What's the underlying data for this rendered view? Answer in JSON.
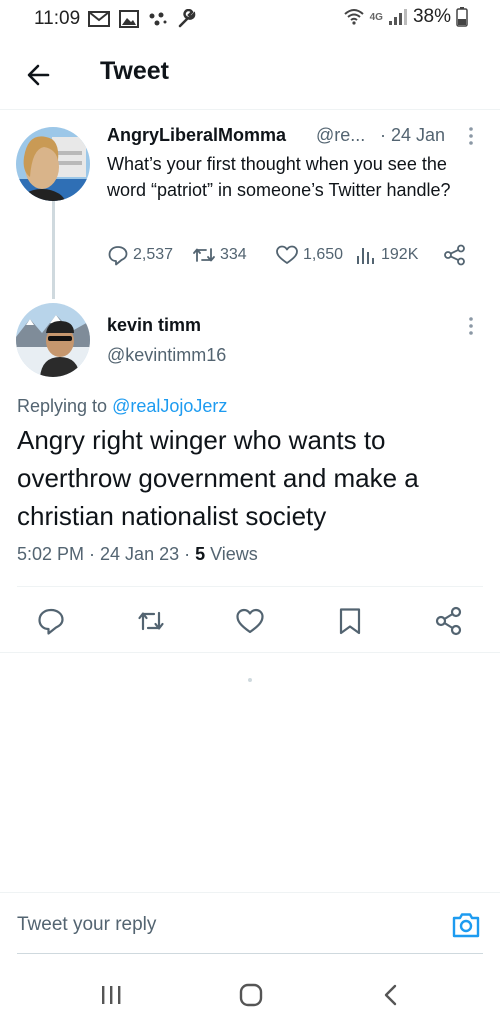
{
  "status_bar": {
    "time": "11:09",
    "left_icons": [
      "gmail-icon",
      "gallery-icon",
      "dots-icon",
      "wrench-icon"
    ],
    "network": "4G",
    "battery": "38%"
  },
  "header": {
    "title": "Tweet"
  },
  "parent_tweet": {
    "display_name": "AngryLiberalMomma",
    "handle": "@re...",
    "date": "· 24 Jan",
    "text": "What’s your first thought when you see the word “patriot” in someone’s Twitter handle?",
    "replies": "2,537",
    "retweets": "334",
    "likes": "1,650",
    "views": "192K"
  },
  "main_tweet": {
    "display_name": "kevin timm",
    "handle": "@kevintimm16",
    "replying_prefix": "Replying to ",
    "replying_to": "@realJojoJerz",
    "text": "Angry right winger who wants to overthrow government and make a christian nationalist society",
    "timestamp": "5:02 PM · 24 Jan 23 · ",
    "views_count": "5",
    "views_label": " Views"
  },
  "reply": {
    "placeholder": "Tweet your reply"
  },
  "colors": {
    "accent": "#1d9bf0",
    "text_primary": "#0f1419",
    "text_secondary": "#536471",
    "divider": "#eff3f4"
  }
}
